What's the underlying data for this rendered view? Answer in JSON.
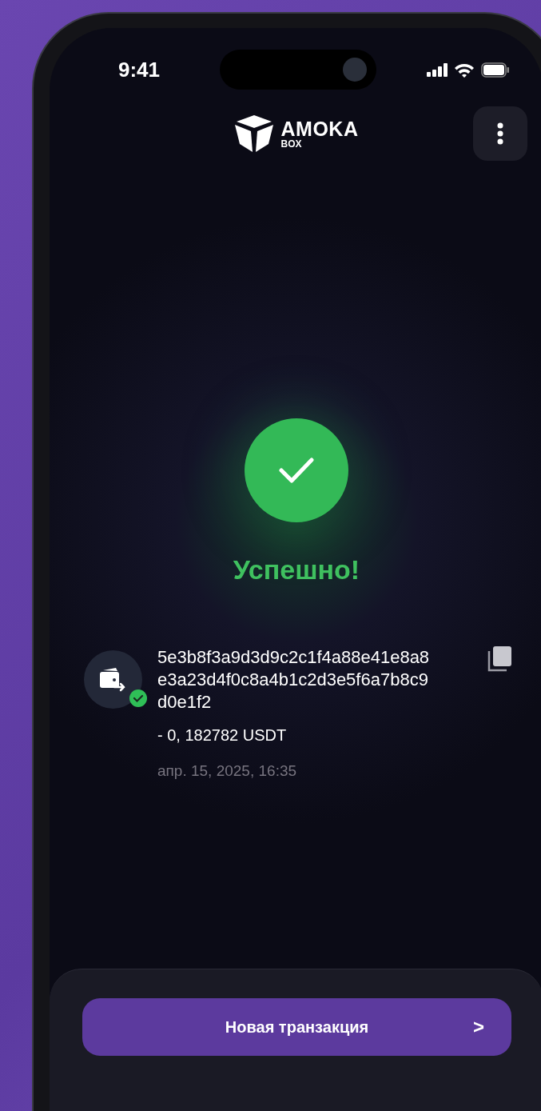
{
  "status_bar": {
    "time": "9:41"
  },
  "header": {
    "logo_text": "AMOKA",
    "logo_subtext": "BOX"
  },
  "result": {
    "title": "Успешно!"
  },
  "transaction": {
    "hash": "5e3b8f3a9d3d9c2c1f4a88e41e8a8e3a23d4f0c8a4b1c2d3e5f6a7b8c9d0e1f2",
    "amount": "- 0, 182782 USDT",
    "date": "апр. 15, 2025, 16:35",
    "confirmed": true
  },
  "button": {
    "label": "Новая транзакция",
    "chevron": ">"
  }
}
